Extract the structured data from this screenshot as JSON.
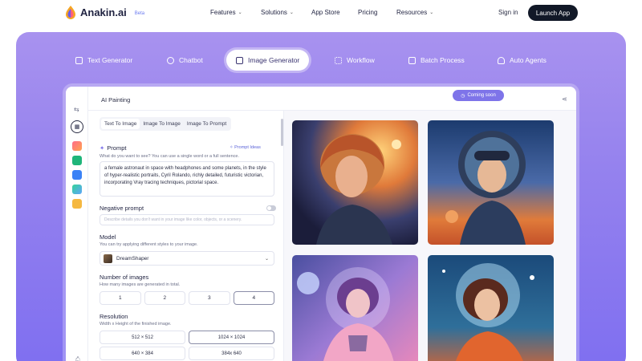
{
  "nav": {
    "brand": "Anakin.ai",
    "beta": "Beta",
    "links": [
      {
        "label": "Features",
        "dropdown": true
      },
      {
        "label": "Solutions",
        "dropdown": true
      },
      {
        "label": "App Store",
        "dropdown": false
      },
      {
        "label": "Pricing",
        "dropdown": false
      },
      {
        "label": "Resources",
        "dropdown": true
      }
    ],
    "sign_in": "Sign in",
    "launch": "Launch App"
  },
  "tabs": [
    {
      "label": "Text Generator",
      "icon": "document-icon",
      "active": false
    },
    {
      "label": "Chatbot",
      "icon": "chat-icon",
      "active": false
    },
    {
      "label": "Image Generator",
      "icon": "image-icon",
      "active": true
    },
    {
      "label": "Workflow",
      "icon": "workflow-icon",
      "active": false
    },
    {
      "label": "Batch Process",
      "icon": "batch-icon",
      "active": false
    },
    {
      "label": "Auto Agents",
      "icon": "agent-icon",
      "active": false
    }
  ],
  "app": {
    "title": "AI Painting",
    "coming_soon": "Coming soon",
    "subtabs": [
      "Text To Image",
      "Image To Image",
      "Image To Prompt"
    ],
    "prompt": {
      "label": "Prompt",
      "ideas": "Prompt Ideas",
      "hint": "What do you want to see? You can use a single word or a full sentence.",
      "value": "a female astronaut in space with headphones and some planets, in the style of hyper-realistic portraits, Cyril Rolando, richly detailed, futuristic victorian, incorporating Vray tracing techniques, pictorial space."
    },
    "negative": {
      "label": "Negative prompt",
      "placeholder": "Describe details you don't want in your image like color, objects, or a scenery."
    },
    "model": {
      "label": "Model",
      "hint": "You can try applying different styles to your image.",
      "value": "DreamShaper"
    },
    "num_images": {
      "label": "Number of images",
      "hint": "How many images are generated in total.",
      "options": [
        "1",
        "2",
        "3",
        "4"
      ],
      "selected": "4"
    },
    "resolution": {
      "label": "Resolution",
      "hint": "Width x Height of the finished image.",
      "options": [
        "512 × 512",
        "1024 × 1024",
        "640 × 384",
        "384x 640"
      ],
      "selected": "1024 × 1024"
    }
  },
  "colors": {
    "hero_top": "#a892ef",
    "hero_bottom": "#7f6ff0",
    "brand_dark": "#111827",
    "accent": "#7e74e9"
  }
}
